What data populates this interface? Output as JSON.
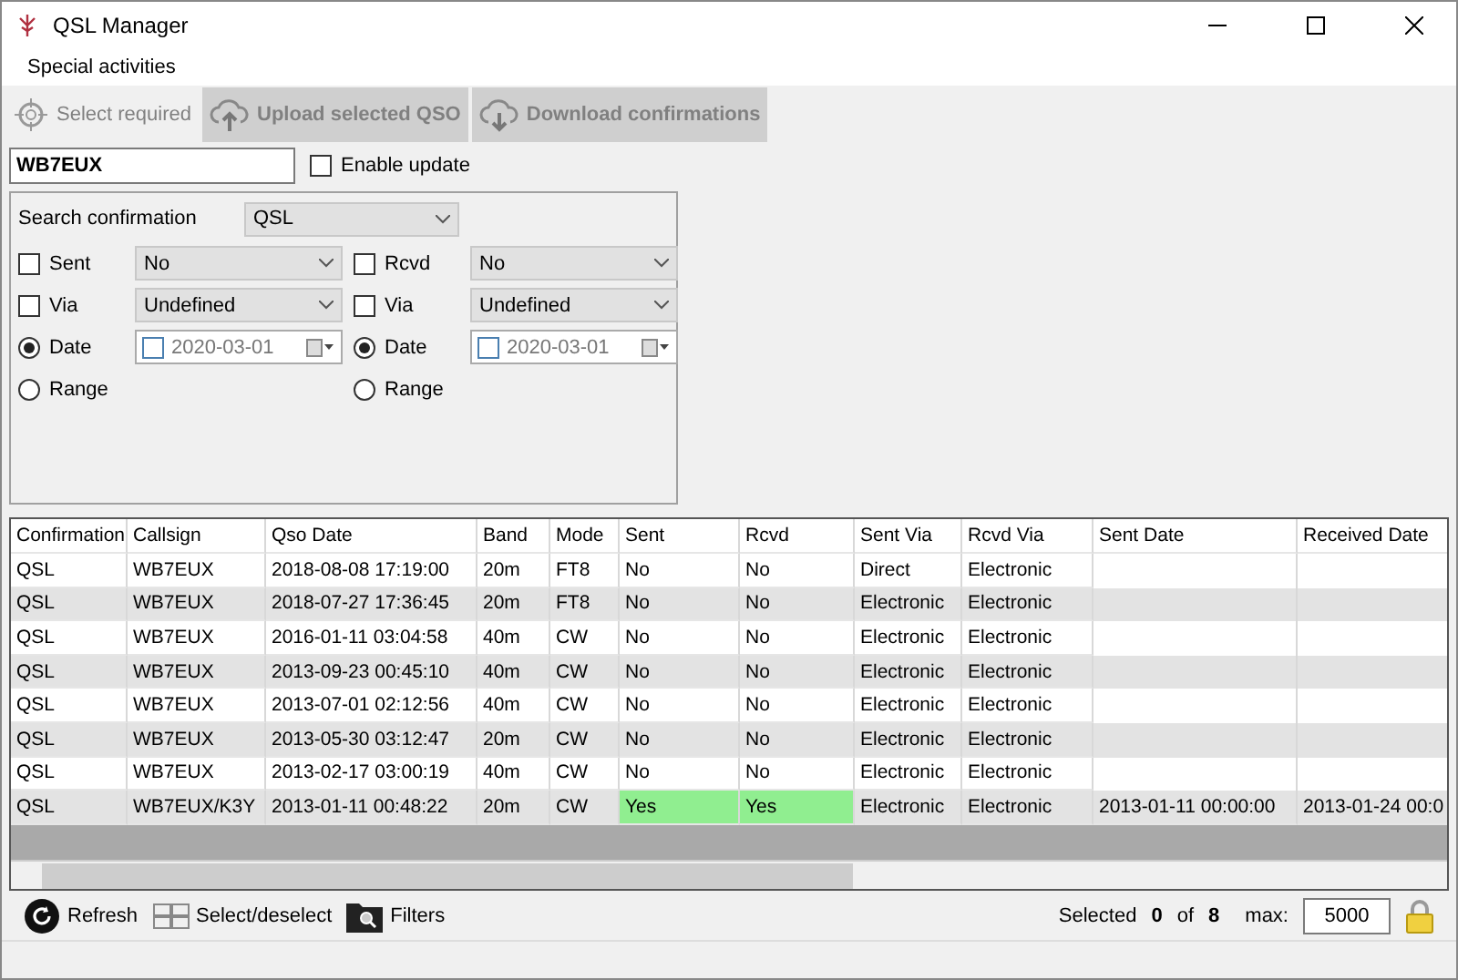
{
  "window": {
    "title": "QSL Manager"
  },
  "menu": [
    "Special activities"
  ],
  "toolbar": [
    {
      "kind": "tool",
      "label": "Select required",
      "disabled": true
    },
    {
      "kind": "upload",
      "label": "Upload selected QSO",
      "disabled": true
    },
    {
      "kind": "download",
      "label": "Download confirmations",
      "disabled": true
    }
  ],
  "callsign": {
    "value": "WB7EUX"
  },
  "enable_update": {
    "label": "Enable update",
    "checked": false
  },
  "search": {
    "label": "Search confirmation",
    "value": "QSL"
  },
  "filters": [
    {
      "status": {
        "label": "Sent",
        "checked": false,
        "value": "No"
      },
      "via": {
        "label": "Via",
        "checked": false,
        "value": "Undefined"
      },
      "date": {
        "label": "Date",
        "selected": true,
        "value": "2020-03-01",
        "checked": false
      },
      "range": {
        "label": "Range",
        "selected": false
      }
    },
    {
      "status": {
        "label": "Rcvd",
        "checked": false,
        "value": "No"
      },
      "via": {
        "label": "Via",
        "checked": false,
        "value": "Undefined"
      },
      "date": {
        "label": "Date",
        "selected": true,
        "value": "2020-03-01",
        "checked": false
      },
      "range": {
        "label": "Range",
        "selected": false
      }
    }
  ],
  "table": {
    "columns": [
      "Confirmation",
      "Callsign",
      "Qso Date",
      "Band",
      "Mode",
      "Sent",
      "Rcvd",
      "Sent Via",
      "Rcvd Via",
      "Sent Date",
      "Received Date"
    ],
    "rows": [
      {
        "confirmation": "QSL",
        "callsign": "WB7EUX",
        "qso_date": "2018-08-08 17:19:00",
        "band": "20m",
        "mode": "FT8",
        "sent": "No",
        "rcvd": "No",
        "sent_via": "Direct",
        "rcvd_via": "Electronic",
        "confirmed": false
      },
      {
        "confirmation": "QSL",
        "callsign": "WB7EUX",
        "qso_date": "2018-07-27 17:36:45",
        "band": "20m",
        "mode": "FT8",
        "sent": "No",
        "rcvd": "No",
        "sent_via": "Electronic",
        "rcvd_via": "Electronic",
        "confirmed": false
      },
      {
        "confirmation": "QSL",
        "callsign": "WB7EUX",
        "qso_date": "2016-01-11 03:04:58",
        "band": "40m",
        "mode": "CW",
        "sent": "No",
        "rcvd": "No",
        "sent_via": "Electronic",
        "rcvd_via": "Electronic",
        "confirmed": false
      },
      {
        "confirmation": "QSL",
        "callsign": "WB7EUX",
        "qso_date": "2013-09-23 00:45:10",
        "band": "40m",
        "mode": "CW",
        "sent": "No",
        "rcvd": "No",
        "sent_via": "Electronic",
        "rcvd_via": "Electronic",
        "confirmed": false
      },
      {
        "confirmation": "QSL",
        "callsign": "WB7EUX",
        "qso_date": "2013-07-01 02:12:56",
        "band": "40m",
        "mode": "CW",
        "sent": "No",
        "rcvd": "No",
        "sent_via": "Electronic",
        "rcvd_via": "Electronic",
        "confirmed": false
      },
      {
        "confirmation": "QSL",
        "callsign": "WB7EUX",
        "qso_date": "2013-05-30 03:12:47",
        "band": "20m",
        "mode": "CW",
        "sent": "No",
        "rcvd": "No",
        "sent_via": "Electronic",
        "rcvd_via": "Electronic",
        "confirmed": false
      },
      {
        "confirmation": "QSL",
        "callsign": "WB7EUX",
        "qso_date": "2013-02-17 03:00:19",
        "band": "40m",
        "mode": "CW",
        "sent": "No",
        "rcvd": "No",
        "sent_via": "Electronic",
        "rcvd_via": "Electronic",
        "confirmed": false
      },
      {
        "confirmation": "QSL",
        "callsign": "WB7EUX/K3Y",
        "qso_date": "2013-01-11 00:48:22",
        "band": "20m",
        "mode": "CW",
        "sent": "Yes",
        "rcvd": "Yes",
        "sent_via": "Electronic",
        "rcvd_via": "Electronic",
        "sent_date": "2013-01-11 00:00:00",
        "received_date": "2013-01-24 00:0",
        "confirmed": true
      }
    ]
  },
  "actions": [
    "Refresh",
    "Select/deselect",
    "Filters"
  ],
  "status": {
    "selected_label": "Selected",
    "selected": "0",
    "of_label": "of",
    "total": "8",
    "max_label": "max:",
    "max": "5000",
    "locked": true
  }
}
